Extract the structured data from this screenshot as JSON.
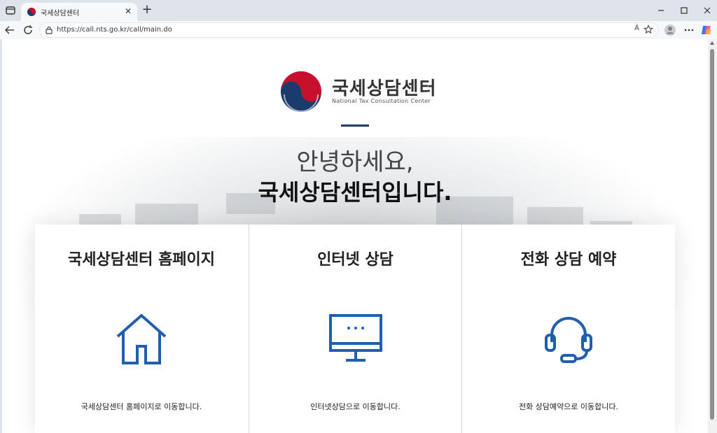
{
  "browser": {
    "tab_title": "국세상담센터",
    "url": "https://call.nts.go.kr/call/main.do",
    "read_aloud": "Á",
    "accent": "#1a3b6b"
  },
  "header": {
    "logo_title": "국세상담센터",
    "logo_subtitle": "National Tax Consultation Center"
  },
  "greeting": {
    "line1": "안녕하세요,",
    "line2": "국세상담센터입니다."
  },
  "cards": [
    {
      "title": "국세상담센터 홈페이지",
      "description": "국세상담센터 홈페이지로 이동합니다.",
      "icon": "home-icon"
    },
    {
      "title": "인터넷 상담",
      "description": "인터넷상담으로 이동합니다.",
      "icon": "monitor-icon"
    },
    {
      "title": "전화 상담 예약",
      "description": "전화 상담예약으로 이동합니다.",
      "icon": "headset-icon"
    }
  ],
  "colors": {
    "icon_blue": "#1f5fae",
    "divider": "#1a3b6b"
  }
}
